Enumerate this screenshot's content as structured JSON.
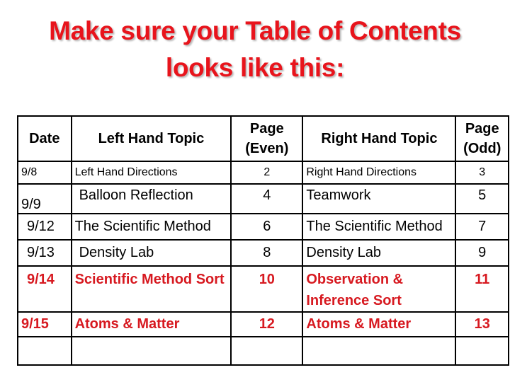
{
  "title": {
    "line1": "Make sure your Table of Contents",
    "line2": "looks like this:"
  },
  "colors": {
    "title_red": "#e8141c",
    "entry_red": "#d71920",
    "text": "#000000",
    "border": "#000000"
  },
  "table": {
    "headers": {
      "date": "Date",
      "left_topic": "Left Hand Topic",
      "page_even": "Page (Even)",
      "right_topic": "Right Hand Topic",
      "page_odd": "Page (Odd)"
    },
    "rows": [
      {
        "date": "9/8",
        "left_topic": "Left Hand Directions",
        "page_even": "2",
        "right_topic": "Right Hand Directions",
        "page_odd": "3",
        "highlight": false
      },
      {
        "date": "9/9",
        "left_topic": "Balloon Reflection",
        "page_even": "4",
        "right_topic": "Teamwork",
        "page_odd": "5",
        "highlight": false
      },
      {
        "date": "9/12",
        "left_topic": "The Scientific Method",
        "page_even": "6",
        "right_topic": "The Scientific Method",
        "page_odd": "7",
        "highlight": false
      },
      {
        "date": "9/13",
        "left_topic": "Density Lab",
        "page_even": "8",
        "right_topic": "Density Lab",
        "page_odd": "9",
        "highlight": false
      },
      {
        "date": "9/14",
        "left_topic": "Scientific Method Sort",
        "page_even": "10",
        "right_topic": "Observation & Inference Sort",
        "page_odd": "11",
        "highlight": true
      },
      {
        "date": "9/15",
        "left_topic": "Atoms & Matter",
        "page_even": "12",
        "right_topic": "Atoms & Matter",
        "page_odd": "13",
        "highlight": true
      },
      {
        "date": "",
        "left_topic": "",
        "page_even": "",
        "right_topic": "",
        "page_odd": "",
        "highlight": false
      }
    ]
  }
}
